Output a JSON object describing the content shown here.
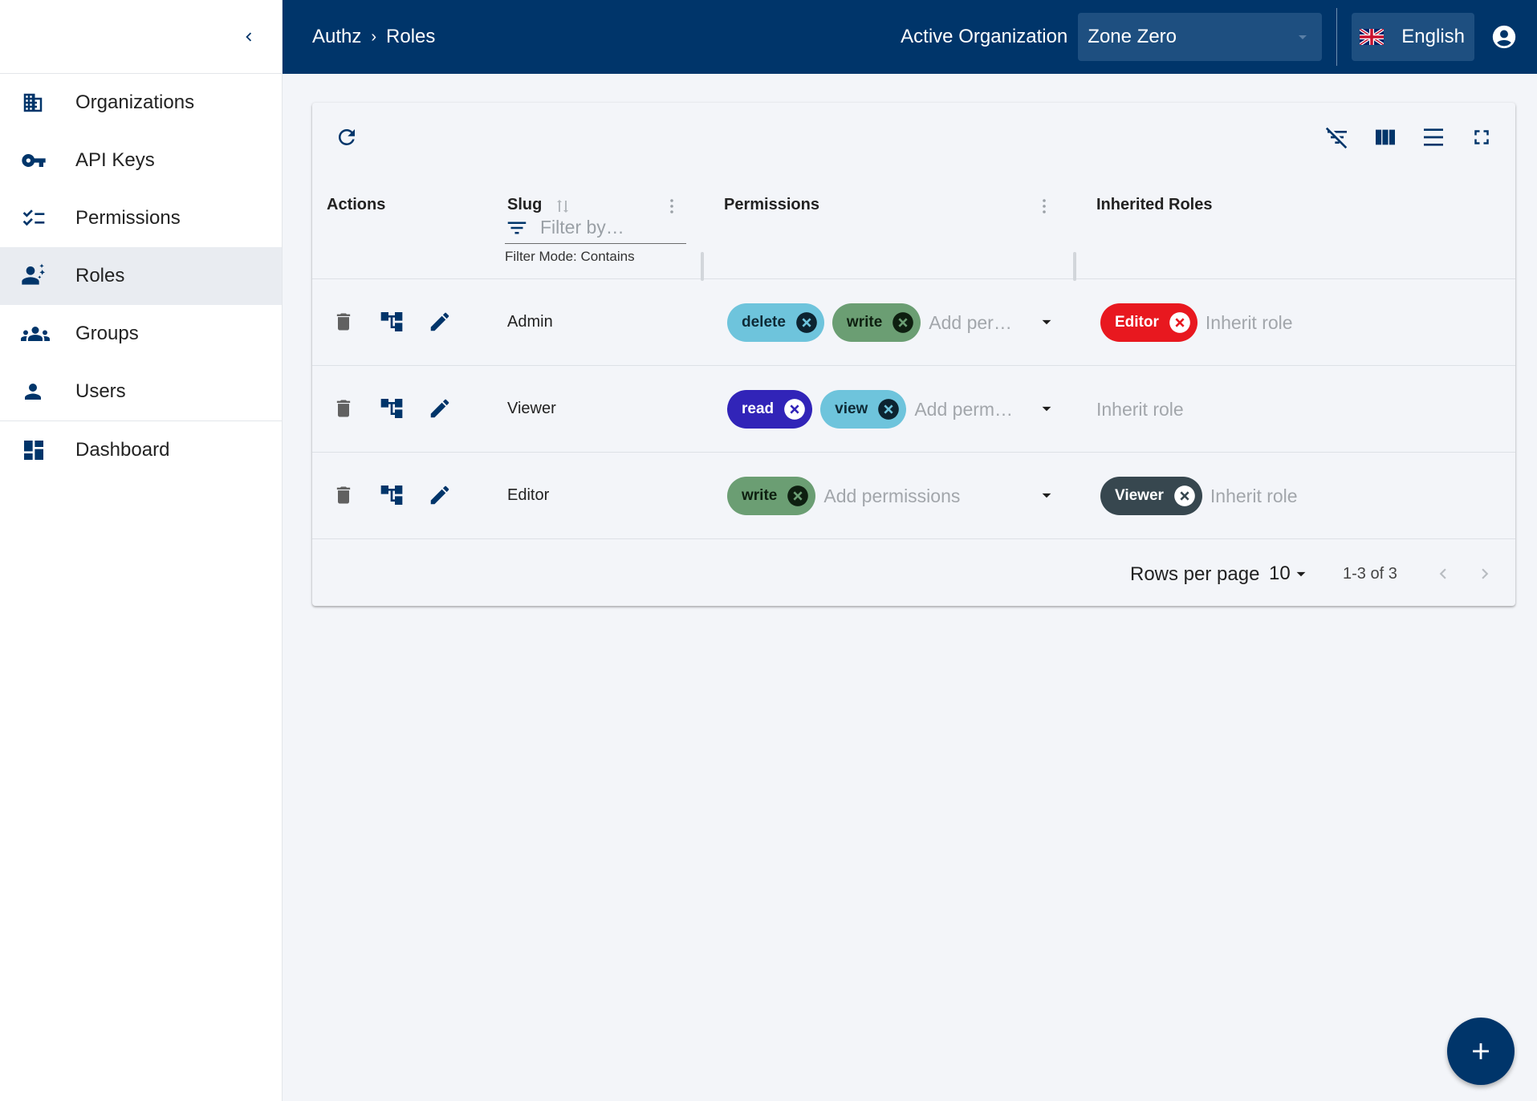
{
  "colors": {
    "primary": "#00356a",
    "sidebar_active": "#e9ecf1",
    "chip_delete": "#6ec4dc",
    "chip_write": "#6b9e73",
    "chip_read": "#3124b8",
    "chip_view": "#6ec4dc",
    "chip_editor_role": "#e8181f",
    "chip_viewer_role": "#37474f"
  },
  "sidebar": {
    "collapse_icon": "chevron-left-icon",
    "items": [
      {
        "label": "Organizations",
        "icon": "building-icon"
      },
      {
        "label": "API Keys",
        "icon": "key-icon"
      },
      {
        "label": "Permissions",
        "icon": "checklist-icon"
      },
      {
        "label": "Roles",
        "icon": "roles-icon",
        "active": true
      },
      {
        "label": "Groups",
        "icon": "groups-icon"
      },
      {
        "label": "Users",
        "icon": "person-icon"
      }
    ],
    "dashboard": {
      "label": "Dashboard",
      "icon": "dashboard-icon"
    }
  },
  "header": {
    "breadcrumb": {
      "root": "Authz",
      "separator": "›",
      "current": "Roles"
    },
    "org_label": "Active Organization",
    "org_value": "Zone Zero",
    "language": "English"
  },
  "table": {
    "columns": {
      "actions": "Actions",
      "slug": "Slug",
      "permissions": "Permissions",
      "inherited": "Inherited Roles"
    },
    "filter_placeholder": "Filter by…",
    "filter_mode": "Filter Mode: Contains",
    "rows": [
      {
        "slug": "Admin",
        "permissions": [
          "delete",
          "write"
        ],
        "perm_placeholder": "Add per…",
        "inherited": [
          "Editor"
        ],
        "inherit_placeholder": "Inherit role"
      },
      {
        "slug": "Viewer",
        "permissions": [
          "read",
          "view"
        ],
        "perm_placeholder": "Add perm…",
        "inherited": [],
        "inherit_placeholder": "Inherit role"
      },
      {
        "slug": "Editor",
        "permissions": [
          "write"
        ],
        "perm_placeholder": "Add permissions",
        "inherited": [
          "Viewer"
        ],
        "inherit_placeholder": "Inherit role"
      }
    ]
  },
  "pagination": {
    "rows_per_page_label": "Rows per page",
    "rows_per_page": "10",
    "range": "1-3 of 3"
  }
}
